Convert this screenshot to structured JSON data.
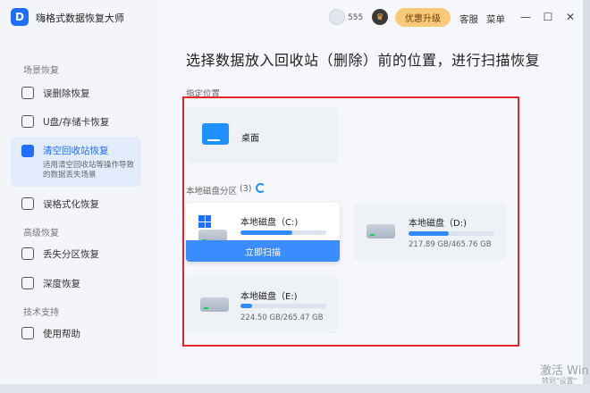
{
  "app": {
    "title": "嗨格式数据恢复大师",
    "logo": "D"
  },
  "sidebar": {
    "sections": [
      "场景恢复",
      "高级恢复",
      "技术支持"
    ],
    "items": [
      {
        "label": "误删除恢复",
        "icon": "file-delete-icon"
      },
      {
        "label": "U盘/存储卡恢复",
        "icon": "usb-icon"
      },
      {
        "label": "清空回收站恢复",
        "icon": "trash-icon",
        "desc": "适用清空回收站等操作导致的数据丢失场景"
      },
      {
        "label": "误格式化恢复",
        "icon": "format-icon"
      },
      {
        "label": "丢失分区恢复",
        "icon": "partition-icon"
      },
      {
        "label": "深度恢复",
        "icon": "deep-scan-icon"
      },
      {
        "label": "使用帮助",
        "icon": "help-book-icon"
      }
    ]
  },
  "titlebar": {
    "points": "555",
    "upgrade": "优惠升级",
    "service": "客服",
    "menu": "菜单",
    "minimize": "—",
    "maximize": "☐",
    "close": "✕"
  },
  "main": {
    "title": "选择数据放入回收站（删除）前的位置，进行扫描恢复",
    "specified_label": "指定位置",
    "desktop_label": "桌面",
    "partition_label": "本地磁盘分区",
    "partition_count": "(3)",
    "drives": [
      {
        "name": "本地磁盘（C:)",
        "fill": 0.6,
        "size": ""
      },
      {
        "name": "本地磁盘（D:)",
        "fill": 0.47,
        "size": "217.89 GB/465.76 GB"
      },
      {
        "name": "本地磁盘（E:)",
        "fill": 0.14,
        "size": "224.50 GB/265.47 GB"
      }
    ],
    "scan_button": "立即扫描"
  },
  "watermark": {
    "line1": "激活 Win",
    "line2": "转到\"设置\""
  }
}
